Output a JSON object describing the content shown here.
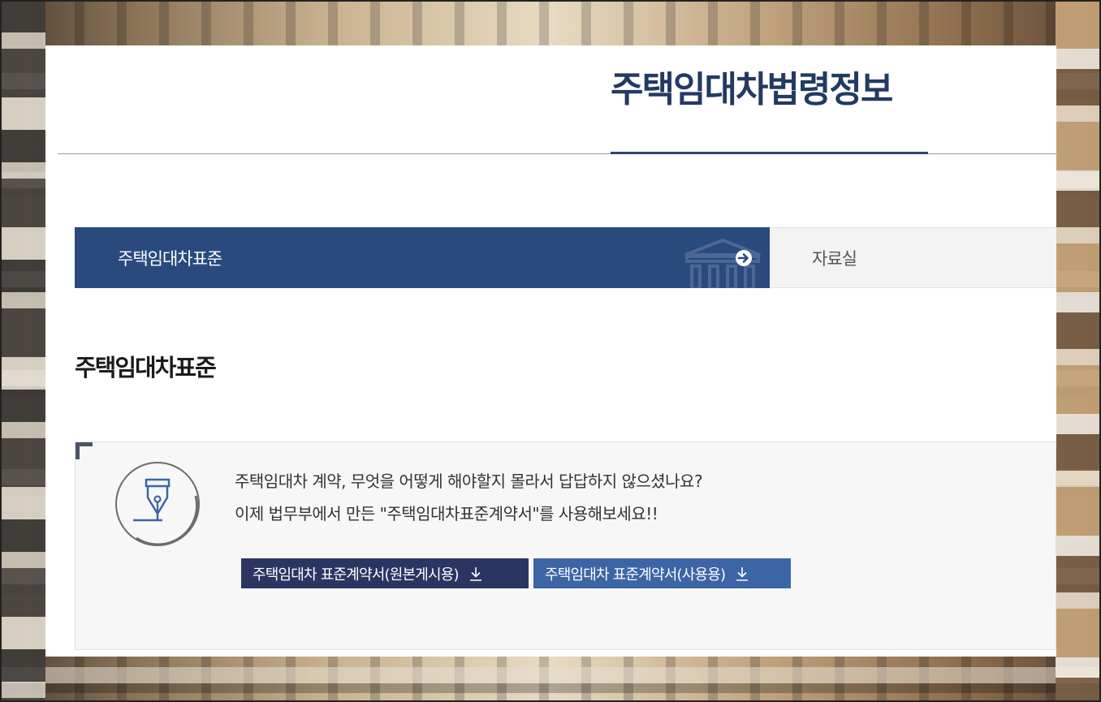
{
  "site": {
    "title": "주택임대차법령정보"
  },
  "tabs": [
    {
      "label": "주택임대차표준",
      "active": true
    },
    {
      "label": "자료실",
      "active": false
    }
  ],
  "section": {
    "heading": "주택임대차표준"
  },
  "info": {
    "line1": "주택임대차 계약, 무엇을 어떻게 해야할지 몰라서 답답하지 않으셨나요?",
    "line2": "이제 법무부에서 만든 \"주택임대차표준계약서\"를 사용해보세요!!"
  },
  "downloads": [
    {
      "label": "주택임대차 표준계약서(원본게시용)",
      "icon": "download-icon"
    },
    {
      "label": "주택임대차 표준계약서(사용용)",
      "icon": "download-icon"
    }
  ],
  "colors": {
    "brand_navy": "#233a63",
    "tab_active_bg": "#2a4a7e",
    "button_dark": "#2b3561",
    "button_light": "#3c65a6"
  }
}
